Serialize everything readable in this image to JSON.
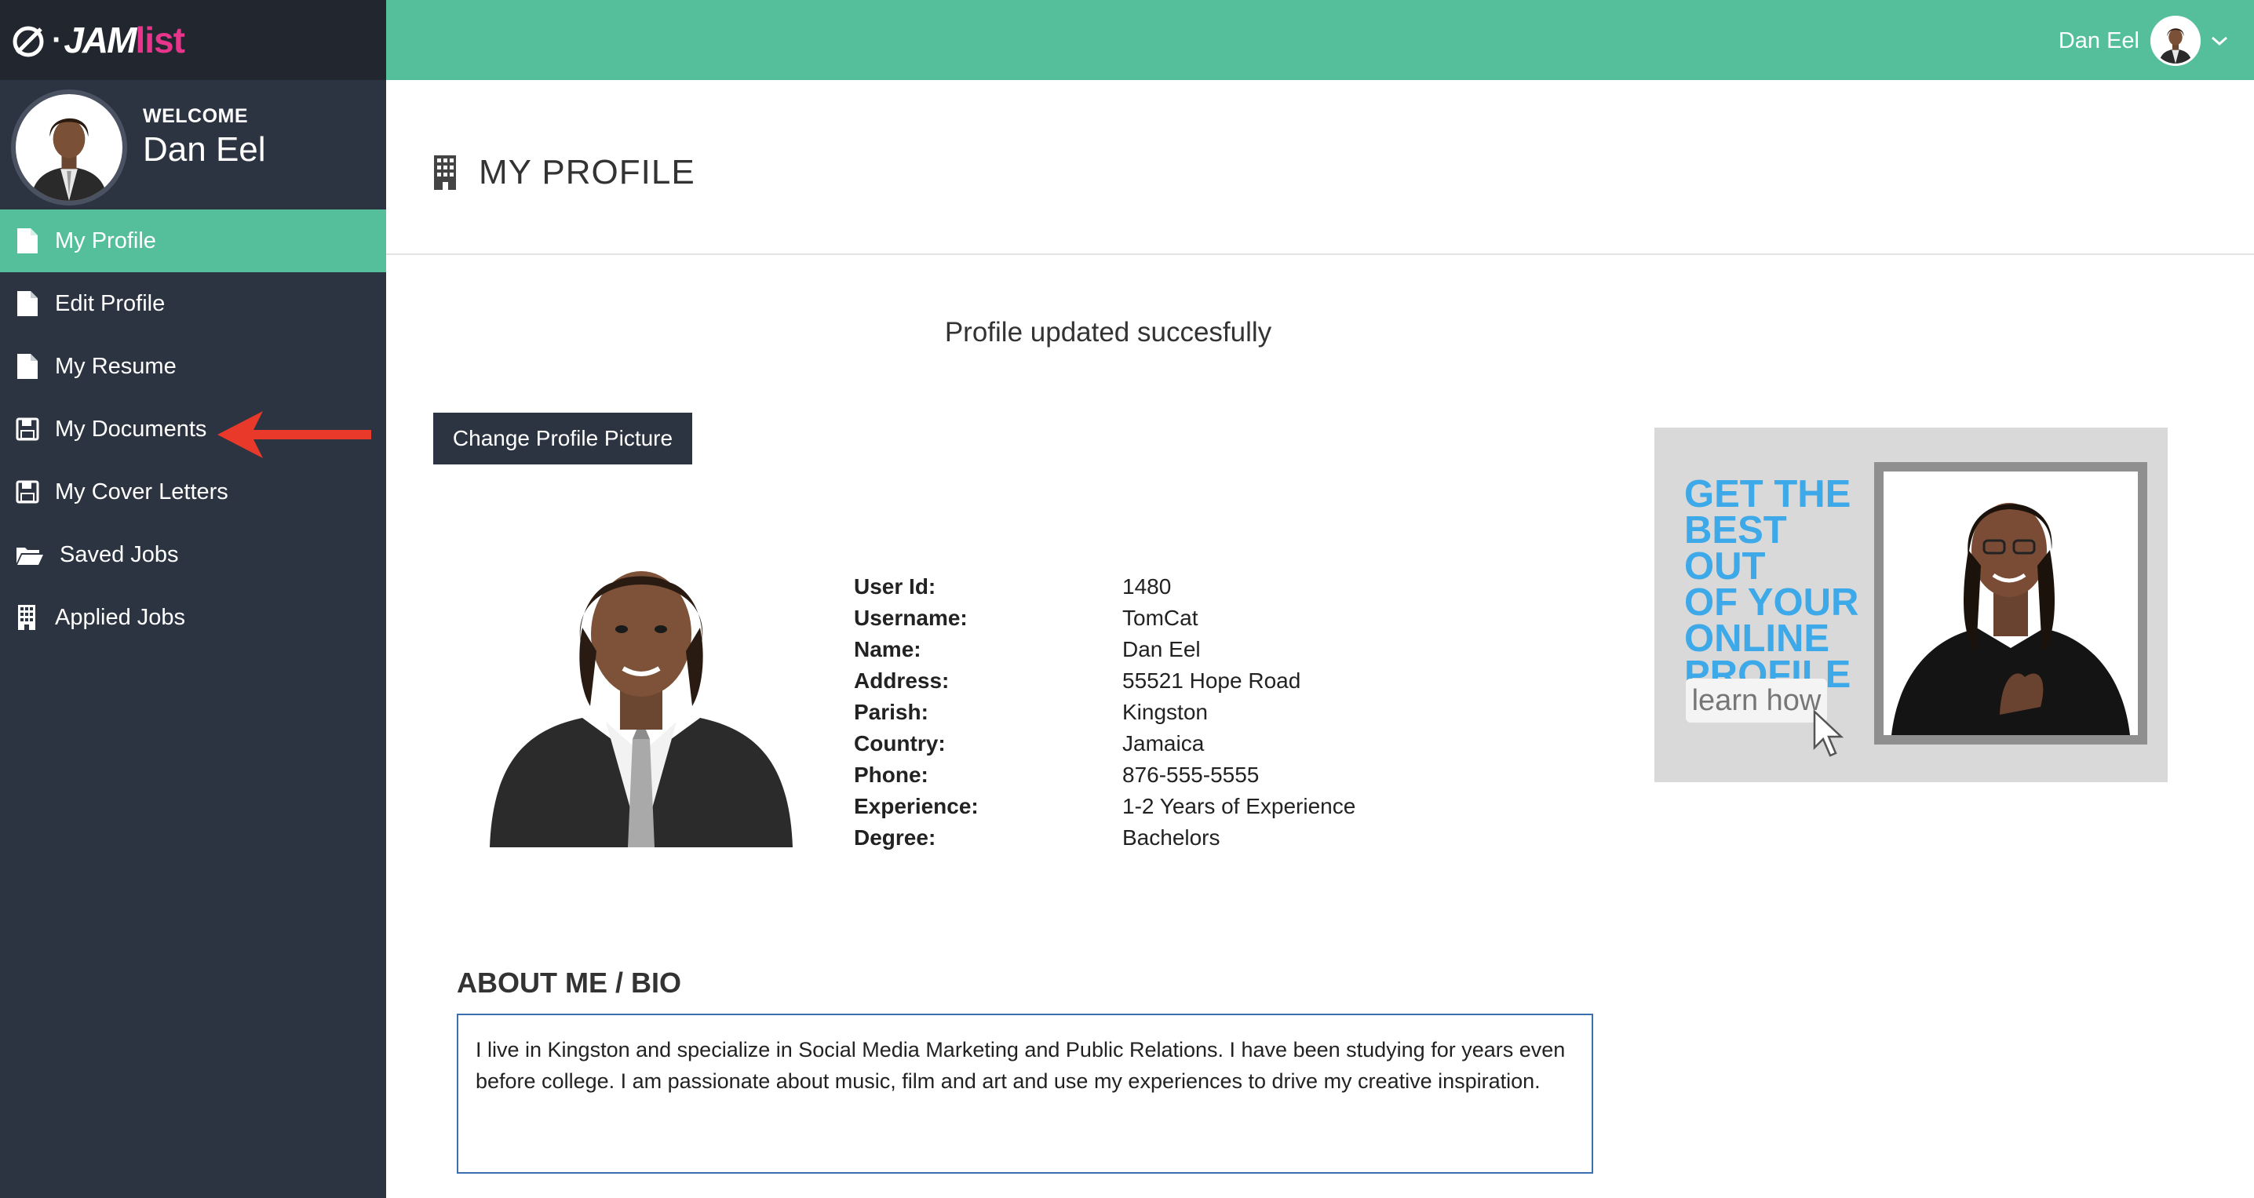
{
  "brand": {
    "prefix": "e",
    "jam": "JAM",
    "list": "list"
  },
  "welcome": {
    "label": "WELCOME",
    "name": "Dan Eel"
  },
  "nav": [
    {
      "label": "My Profile",
      "icon": "file-icon",
      "active": true
    },
    {
      "label": "Edit Profile",
      "icon": "file-icon"
    },
    {
      "label": "My Resume",
      "icon": "file-icon"
    },
    {
      "label": "My Documents",
      "icon": "floppy-disk-icon"
    },
    {
      "label": "My Cover Letters",
      "icon": "floppy-disk-icon"
    },
    {
      "label": "Saved Jobs",
      "icon": "folder-open-icon"
    },
    {
      "label": "Applied Jobs",
      "icon": "building-icon"
    }
  ],
  "topbar": {
    "user_name": "Dan Eel"
  },
  "page": {
    "title": "MY PROFILE",
    "flash": "Profile updated succesfully"
  },
  "buttons": {
    "change_picture": "Change Profile Picture"
  },
  "profile": {
    "fields": [
      {
        "label": "User Id:",
        "value": "1480"
      },
      {
        "label": "Username:",
        "value": "TomCat"
      },
      {
        "label": "Name:",
        "value": "Dan Eel"
      },
      {
        "label": "Address:",
        "value": "55521 Hope Road"
      },
      {
        "label": "Parish:",
        "value": "Kingston"
      },
      {
        "label": "Country:",
        "value": "Jamaica"
      },
      {
        "label": "Phone:",
        "value": "876-555-5555"
      },
      {
        "label": "Experience:",
        "value": "1-2 Years of Experience"
      },
      {
        "label": "Degree:",
        "value": "Bachelors"
      }
    ]
  },
  "ad": {
    "line1": "GET THE",
    "line2": "BEST OUT",
    "line3": "OF YOUR",
    "line4": "ONLINE",
    "line5": "PROFILE",
    "cta": "learn how"
  },
  "bio": {
    "title": "ABOUT ME / BIO",
    "text": "I live in Kingston and  specialize in Social Media Marketing and Public Relations. I have been studying for years even before college.  I am passionate about music, film and art and use my experiences to drive my creative inspiration."
  },
  "colors": {
    "accent": "#55bf9b",
    "sidebar": "#2c3341",
    "brand_pink": "#e6358b",
    "ad_blue": "#3da9e8",
    "annotation_red": "#e8392b"
  }
}
